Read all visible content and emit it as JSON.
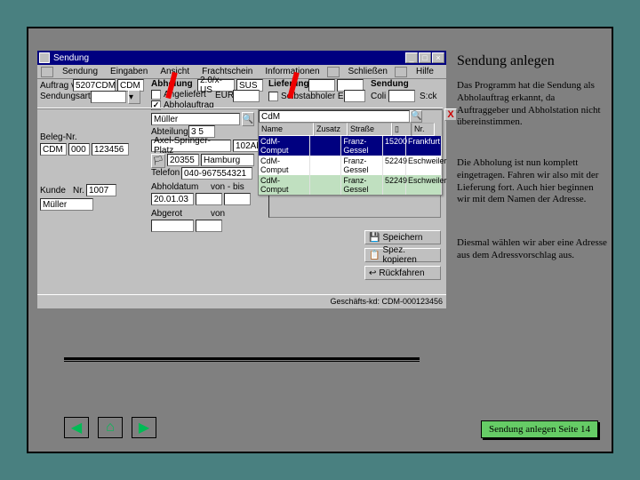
{
  "window": {
    "title": "Sendung",
    "menus": [
      "Sendung",
      "Eingaben",
      "Ansicht",
      "Frachtschein",
      "Informationen",
      "Schließen",
      "Hilfe"
    ]
  },
  "header": {
    "auftrag_label": "Auftrag von",
    "auftrag1": "5207CDM",
    "auftrag2": "CDM",
    "sendungsart_label": "Sendungsart",
    "abholung_label": "Abholung",
    "angelefert_label": "Angeliefert",
    "abholauftrag_label": "Abholauftrag",
    "code1": "2.0/x-US",
    "code2": "SUS",
    "eur": "EUR",
    "lieferung_label": "Lieferung",
    "selbstabholer_label": "Selbstabholer ELF",
    "sendung_label": "Sendung",
    "coli_label": "Coli",
    "sck_label": "S:ck"
  },
  "fields": {
    "name1": "Müller",
    "abteilung_label": "Abteilung",
    "abt_val": "3 5",
    "addr2": "Axel-Springer-Platz",
    "addr2b": "102Ab",
    "plz": "20355",
    "ort": "Hamburg",
    "land_ic": "de",
    "telefon_label": "Telefon",
    "telefon": "040-967554321",
    "abholdatum_label": "Abholdatum",
    "vonbis_label": "von - bis",
    "abholdatum": "20.01.03",
    "abgerot_label": "Abgerot",
    "von_label": "von",
    "beleg_label": "Beleg-Nr.",
    "beleg1": "CDM",
    "beleg2": "000",
    "beleg3": "123456",
    "kunde_label": "Kunde",
    "kunde_nr_label": "Nr.",
    "kunde_nr": "1007",
    "kunde_name": "Müller"
  },
  "popup": {
    "filter": "CdM",
    "cols": {
      "name": "Name",
      "zusatz": "Zusatz",
      "strasse": "Straße",
      "nr": "Nr."
    },
    "rows": [
      {
        "name": "CdM-Comput",
        "str": "Franz-Gessel",
        "plz": "15200",
        "ort": "Frankfurt"
      },
      {
        "name": "CdM-Comput",
        "str": "Franz-Gessel",
        "plz": "52249",
        "ort": "Eschweiler"
      },
      {
        "name": "CdM-Comput",
        "str": "Franz-Gessel",
        "plz": "52249",
        "ort": "Eschweiler"
      }
    ]
  },
  "buttons": {
    "speichern": "Speichern",
    "kopieren": "Spez. kopieren",
    "rueckfahren": "Rückfahren"
  },
  "status": "Geschäfts-kd: CDM-000123456",
  "side": {
    "title": "Sendung anlegen",
    "p1": "Das Programm hat die Sendung als Abholauftrag erkannt, da Auftraggeber und Abholstation nicht übereinstimmen.",
    "p2": "Die Abholung ist nun komplett eingetragen. Fahren wir also mit der Lieferung fort. Auch hier beginnen wir mit dem Namen der Adresse.",
    "p3": "Diesmal wählen wir aber eine Adresse aus dem Adressvorschlag aus."
  },
  "footer": "Sendung anlegen Seite 14"
}
